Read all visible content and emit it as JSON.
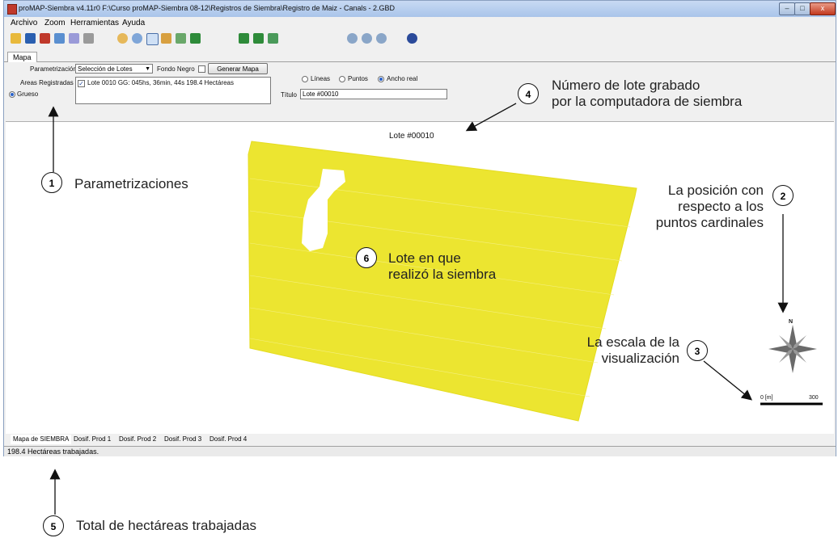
{
  "window": {
    "title": "proMAP-Siembra v4.11r0    F:\\Curso proMAP-Siembra 08-12\\Registros de Siembra\\Registro de Maiz - Canals - 2.GBD",
    "min": "–",
    "max": "□",
    "close": "x"
  },
  "menu": [
    "Archivo",
    "Zoom",
    "Herramientas",
    "Ayuda"
  ],
  "tab": "Mapa",
  "params": {
    "param_label": "Parametrización",
    "param_value": "Selección de Lotes",
    "fondo_label": "Fondo Negro",
    "generar_button": "Generar Mapa",
    "areas_label": "Areas Registradas",
    "area_item": "Lote 0010 GG: 045hs, 36min, 44s 198.4 Hectáreas",
    "grueso_label": "Grueso",
    "lineas_label": "Líneas",
    "puntos_label": "Puntos",
    "ancho_label": "Ancho real",
    "titulo_label": "Título",
    "titulo_value": "Lote #00010"
  },
  "map": {
    "title": "Lote #00010",
    "field_color": "#ece530",
    "north_label": "N",
    "scale_start": "0 [m]",
    "scale_end": "300"
  },
  "bottom_tabs": [
    "Mapa de SIEMBRA",
    "Dosif. Prod 1",
    "Dosif. Prod 2",
    "Dosif. Prod 3",
    "Dosif. Prod 4"
  ],
  "status": "198.4 Hectáreas trabajadas.",
  "annotations": [
    {
      "num": "1",
      "text": "Parametrizaciones"
    },
    {
      "num": "2",
      "text_lines": [
        "La posición con",
        "respecto a los",
        "puntos cardinales"
      ]
    },
    {
      "num": "3",
      "text_lines": [
        "La escala de la",
        "visualización"
      ]
    },
    {
      "num": "4",
      "text_lines": [
        "Número de lote grabado",
        "por la computadora de siembra"
      ]
    },
    {
      "num": "5",
      "text": "Total de hectáreas trabajadas"
    },
    {
      "num": "6",
      "text_lines": [
        "Lote en que",
        "realizó la siembra"
      ]
    }
  ]
}
